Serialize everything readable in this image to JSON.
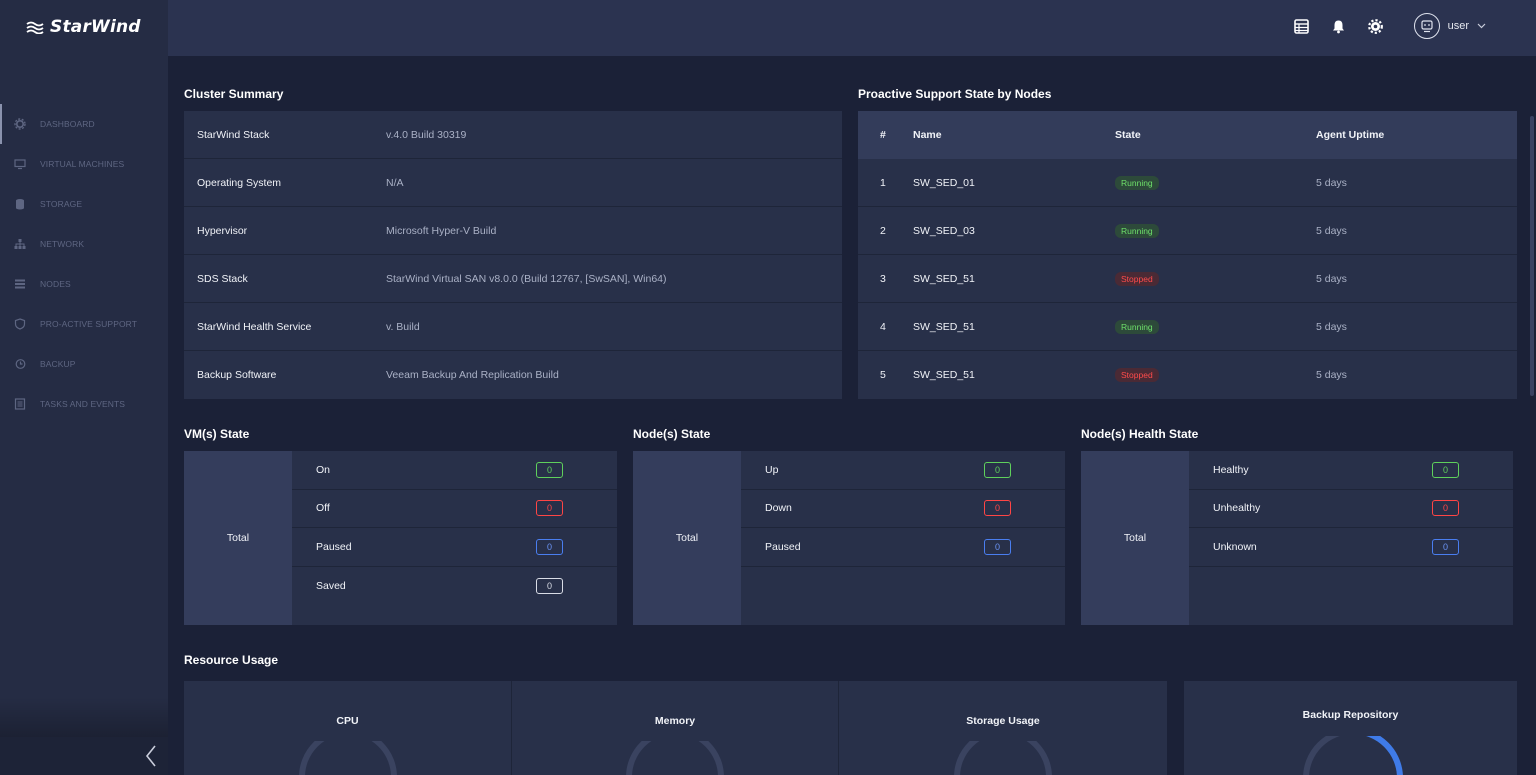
{
  "app": {
    "brand": "StarWind"
  },
  "sidebar": {
    "items": [
      {
        "label": "DASHBOARD",
        "icon": "gear-icon"
      },
      {
        "label": "VIRTUAL MACHINES",
        "icon": "monitor-icon"
      },
      {
        "label": "STORAGE",
        "icon": "database-icon"
      },
      {
        "label": "NETWORK",
        "icon": "network-icon"
      },
      {
        "label": "NODES",
        "icon": "list-icon"
      },
      {
        "label": "PRO-ACTIVE SUPPORT",
        "icon": "shield-icon"
      },
      {
        "label": "BACKUP",
        "icon": "history-icon"
      },
      {
        "label": "TASKS AND EVENTS",
        "icon": "tasks-icon"
      }
    ]
  },
  "header": {
    "user": "user"
  },
  "cluster_summary": {
    "title": "Cluster Summary",
    "rows": [
      {
        "key": "StarWind Stack",
        "value": "v.4.0 Build 30319"
      },
      {
        "key": "Operating System",
        "value": "N/A"
      },
      {
        "key": "Hypervisor",
        "value": "Microsoft Hyper-V Build"
      },
      {
        "key": "SDS Stack",
        "value": "StarWind Virtual SAN v8.0.0 (Build 12767, [SwSAN], Win64)"
      },
      {
        "key": "StarWind Health Service",
        "value": "v. Build"
      },
      {
        "key": "Backup Software",
        "value": "Veeam Backup And Replication Build"
      }
    ]
  },
  "proactive": {
    "title": "Proactive Support State by Nodes",
    "columns": [
      "#",
      "Name",
      "State",
      "Agent Uptime"
    ],
    "rows": [
      {
        "num": "1",
        "name": "SW_SED_01",
        "state": "Running",
        "uptime": "5 days"
      },
      {
        "num": "2",
        "name": "SW_SED_03",
        "state": "Running",
        "uptime": "5 days"
      },
      {
        "num": "3",
        "name": "SW_SED_51",
        "state": "Stopped",
        "uptime": "5 days"
      },
      {
        "num": "4",
        "name": "SW_SED_51",
        "state": "Running",
        "uptime": "5 days"
      },
      {
        "num": "5",
        "name": "SW_SED_51",
        "state": "Stopped",
        "uptime": "5 days"
      }
    ]
  },
  "vm_state": {
    "title": "VM(s) State",
    "total_label": "Total",
    "rows": [
      {
        "label": "On",
        "count": "0"
      },
      {
        "label": "Off",
        "count": "0"
      },
      {
        "label": "Paused",
        "count": "0"
      },
      {
        "label": "Saved",
        "count": "0"
      }
    ]
  },
  "node_state": {
    "title": "Node(s) State",
    "total_label": "Total",
    "rows": [
      {
        "label": "Up",
        "count": "0"
      },
      {
        "label": "Down",
        "count": "0"
      },
      {
        "label": "Paused",
        "count": "0"
      }
    ]
  },
  "node_health": {
    "title": "Node(s) Health State",
    "total_label": "Total",
    "rows": [
      {
        "label": "Healthy",
        "count": "0"
      },
      {
        "label": "Unhealthy",
        "count": "0"
      },
      {
        "label": "Unknown",
        "count": "0"
      }
    ]
  },
  "resource_usage": {
    "title": "Resource Usage",
    "cpu_label": "CPU",
    "memory_label": "Memory",
    "storage_label": "Storage Usage",
    "backup_label": "Backup Repository"
  },
  "colors": {
    "running": "#6ee06a",
    "stopped": "#ff4b4b",
    "accent_blue": "#3f7be8"
  }
}
